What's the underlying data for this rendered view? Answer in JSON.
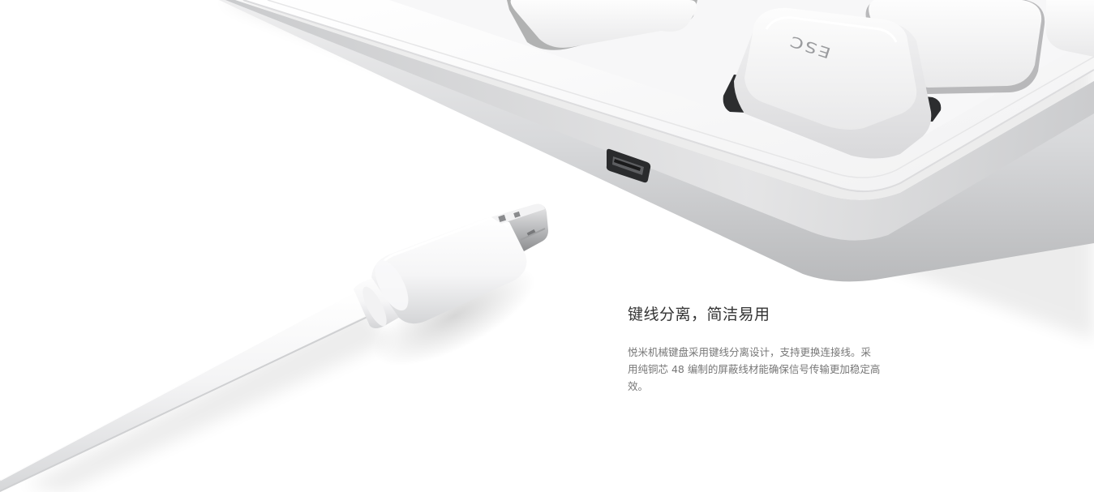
{
  "feature": {
    "title": "键线分离，简洁易用",
    "description": "悦米机械键盘采用键线分离设计，支持更换连接线。采用纯铜芯 48 编制的屏蔽线材能确保信号传输更加稳定高效。"
  },
  "keycap": {
    "legend": "ESC"
  },
  "colors": {
    "background": "#ffffff",
    "title": "#333333",
    "body_text": "#777777",
    "aluminum": "#cfd0d2",
    "keycap": "#f7f7f7"
  },
  "icons": {
    "port": "micro-usb-port-icon",
    "connector": "micro-usb-connector-icon"
  }
}
